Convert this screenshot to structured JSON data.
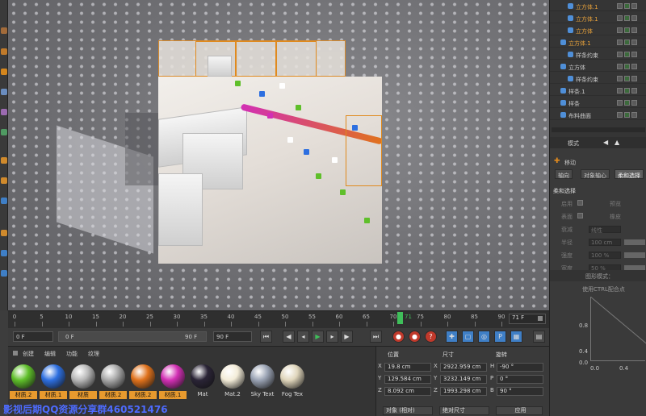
{
  "object_manager": {
    "rows": [
      {
        "label": "立方体.1",
        "indent": 2,
        "color": "#e8a13a"
      },
      {
        "label": "立方体.1",
        "indent": 2,
        "color": "#e8a13a"
      },
      {
        "label": "立方体",
        "indent": 2,
        "color": "#e8a13a"
      },
      {
        "label": "立方体.1",
        "indent": 1,
        "color": "#e8a13a"
      },
      {
        "label": "样条约束",
        "indent": 2,
        "color": "#c8c8c8"
      },
      {
        "label": "立方体",
        "indent": 1,
        "color": "#c8c8c8"
      },
      {
        "label": "样条约束",
        "indent": 2,
        "color": "#c8c8c8"
      },
      {
        "label": "样条.1",
        "indent": 1,
        "color": "#c8c8c8"
      },
      {
        "label": "样条",
        "indent": 1,
        "color": "#c8c8c8"
      },
      {
        "label": "布料曲面",
        "indent": 1,
        "color": "#c8c8c8"
      }
    ]
  },
  "attributes": {
    "mode_label": "模式",
    "object_label": "移动",
    "tabs": [
      "轴向",
      "对象轴心",
      "柔和选择"
    ],
    "section_title": "柔和选择",
    "params": [
      {
        "label": "启用",
        "value": "",
        "extra": "预览"
      },
      {
        "label": "表面",
        "value": "",
        "extra": "橡皮"
      },
      {
        "label": "衰减",
        "value": "线性",
        "extra": ""
      },
      {
        "label": "半径",
        "value": "100 cm",
        "extra": ""
      },
      {
        "label": "强度",
        "value": "100 %",
        "extra": ""
      },
      {
        "label": "宽度",
        "value": "50 %",
        "extra": ""
      }
    ],
    "hint_line1": "图形模式：",
    "hint_line2": "使用CTRL配合点",
    "graph_labels": [
      "0.8",
      "0.4",
      "0.0"
    ],
    "graph_x_labels": [
      "0.0",
      "0.4"
    ]
  },
  "timeline": {
    "ticks": [
      "0",
      "5",
      "10",
      "15",
      "20",
      "25",
      "30",
      "35",
      "40",
      "45",
      "50",
      "55",
      "60",
      "65",
      "70",
      "75",
      "80",
      "85",
      "90"
    ],
    "current": "71",
    "end_frame": "71 F"
  },
  "transport": {
    "start": "0 F",
    "range_start": "0 F",
    "range_end": "90 F",
    "end": "90 F"
  },
  "materials": {
    "menu": [
      "创建",
      "编辑",
      "功能",
      "纹理"
    ],
    "items": [
      {
        "label": "材质.2",
        "color": "#5fbf2a",
        "selected": true
      },
      {
        "label": "材质.1",
        "color": "#2d6fe0",
        "selected": true
      },
      {
        "label": "材质",
        "color": "#b8b8b8",
        "selected": true
      },
      {
        "label": "材质.2",
        "color": "#a9a9a9",
        "selected": true
      },
      {
        "label": "材质.2",
        "color": "#e0721c",
        "selected": true
      },
      {
        "label": "材质.1",
        "color": "#d22fb4",
        "selected": true
      },
      {
        "label": "Mat",
        "color": "#2a2436",
        "selected": false
      },
      {
        "label": "Mat.2",
        "color": "#f3ecd8",
        "selected": false
      },
      {
        "label": "Sky Text",
        "color": "#9aa3b4",
        "selected": false
      },
      {
        "label": "Fog Tex",
        "color": "#e0d6bc",
        "selected": false
      }
    ]
  },
  "coordinates": {
    "headers": [
      "位置",
      "尺寸",
      "旋转"
    ],
    "rows": [
      {
        "axis": "X",
        "pos": "19.8 cm",
        "size_axis": "X",
        "size": "2922.959 cm",
        "rot_axis": "H",
        "rot": "-90 °"
      },
      {
        "axis": "Y",
        "pos": "129.584 cm",
        "size_axis": "Y",
        "size": "3232.149 cm",
        "rot_axis": "P",
        "rot": "0 °"
      },
      {
        "axis": "Z",
        "pos": "8.092 cm",
        "size_axis": "Z",
        "size": "1993.298 cm",
        "rot_axis": "B",
        "rot": "90 °"
      }
    ],
    "mode_object": "对象 (相对)",
    "mode_size": "绝对尺寸",
    "apply": "应用"
  },
  "watermark": "影视后期QQ资源分享群460521476"
}
